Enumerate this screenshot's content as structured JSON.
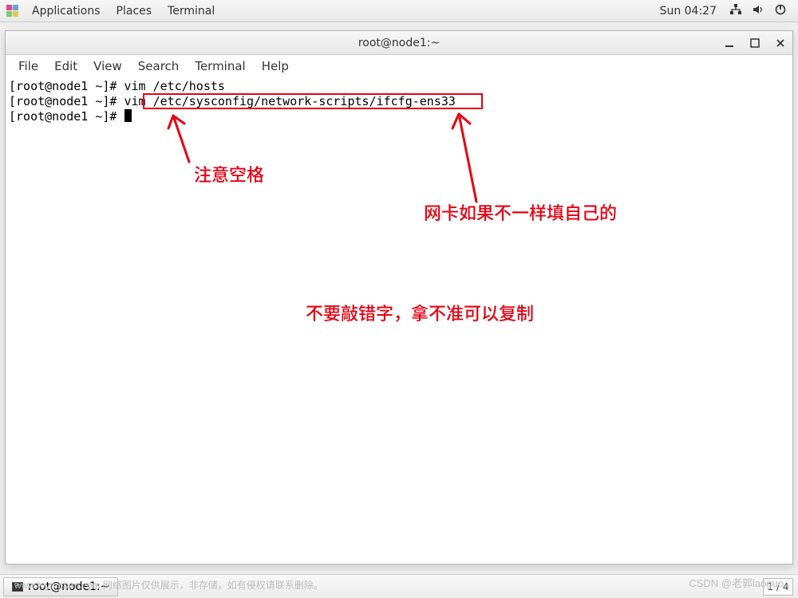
{
  "panel": {
    "applications": "Applications",
    "places": "Places",
    "terminal": "Terminal",
    "clock": "Sun 04:27"
  },
  "window": {
    "title": "root@node1:~"
  },
  "menubar": {
    "file": "File",
    "edit": "Edit",
    "view": "View",
    "search": "Search",
    "terminal": "Terminal",
    "help": "Help"
  },
  "terminal": {
    "line1_prompt": "[root@node1 ~]# ",
    "line1_cmd": "vim /etc/hosts",
    "line2_prompt": "[root@node1 ~]# ",
    "line2_cmd": "vim /etc/sysconfig/network-scripts/ifcfg-ens33",
    "line3_prompt": "[root@node1 ~]# "
  },
  "annotations": {
    "note_space": "注意空格",
    "note_nic": "网卡如果不一样填自己的",
    "note_typo": "不要敲错字，拿不准可以复制"
  },
  "taskbar": {
    "task_title": "root@node1:~",
    "workspace": "1 / 4"
  },
  "watermarks": {
    "left": "www.toymoban.com 网络图片仅供展示，非存储，如有侵权请联系删除。",
    "right": "CSDN @老郭laoguo"
  },
  "colors": {
    "red": "#e60012"
  }
}
